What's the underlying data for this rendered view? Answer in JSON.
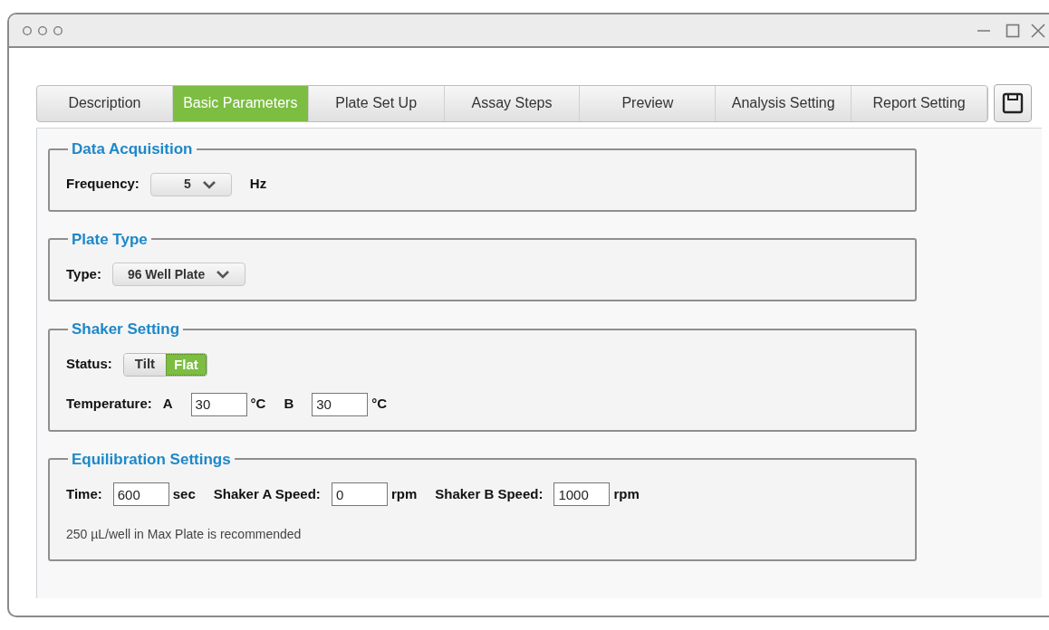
{
  "tabs": [
    {
      "label": "Description",
      "selected": false
    },
    {
      "label": "Basic Parameters",
      "selected": true
    },
    {
      "label": "Plate Set Up",
      "selected": false
    },
    {
      "label": "Assay Steps",
      "selected": false
    },
    {
      "label": "Preview",
      "selected": false
    },
    {
      "label": "Analysis Setting",
      "selected": false
    },
    {
      "label": "Report Setting",
      "selected": false
    }
  ],
  "sections": [
    {
      "title": "Data Acquisition",
      "rows": [
        [
          {
            "kind": "label",
            "text": "Frequency:"
          },
          {
            "kind": "select",
            "value": "5"
          },
          {
            "kind": "unit",
            "text": "Hz"
          }
        ]
      ]
    },
    {
      "title": "Plate Type",
      "rows": [
        [
          {
            "kind": "label",
            "text": "Type:"
          },
          {
            "kind": "select",
            "value": "96 Well Plate"
          }
        ]
      ]
    },
    {
      "title": "Shaker Setting",
      "rows": [
        [
          {
            "kind": "label",
            "text": "Status:"
          },
          {
            "kind": "toggle",
            "options": [
              {
                "label": "Tilt",
                "selected": false
              },
              {
                "label": "Flat",
                "selected": true
              }
            ]
          }
        ],
        [
          {
            "kind": "label",
            "text": "Temperature:"
          },
          {
            "kind": "unit",
            "text": "A"
          },
          {
            "kind": "input",
            "value": "30"
          },
          {
            "kind": "unit",
            "text": "°C"
          },
          {
            "kind": "unit",
            "text": "B"
          },
          {
            "kind": "input",
            "value": "30"
          },
          {
            "kind": "unit",
            "text": "°C"
          }
        ]
      ]
    },
    {
      "title": "Equilibration Settings",
      "rows": [
        [
          {
            "kind": "label",
            "text": "Time:"
          },
          {
            "kind": "input",
            "value": "600"
          },
          {
            "kind": "unit",
            "text": "sec"
          },
          {
            "kind": "label",
            "text": "Shaker A Speed:"
          },
          {
            "kind": "input",
            "value": "0"
          },
          {
            "kind": "unit",
            "text": "rpm"
          },
          {
            "kind": "label",
            "text": "Shaker B Speed:"
          },
          {
            "kind": "input",
            "value": "1000"
          },
          {
            "kind": "unit",
            "text": "rpm"
          }
        ],
        [
          {
            "kind": "note",
            "text": "250 µL/well in Max Plate is recommended"
          }
        ]
      ]
    }
  ]
}
